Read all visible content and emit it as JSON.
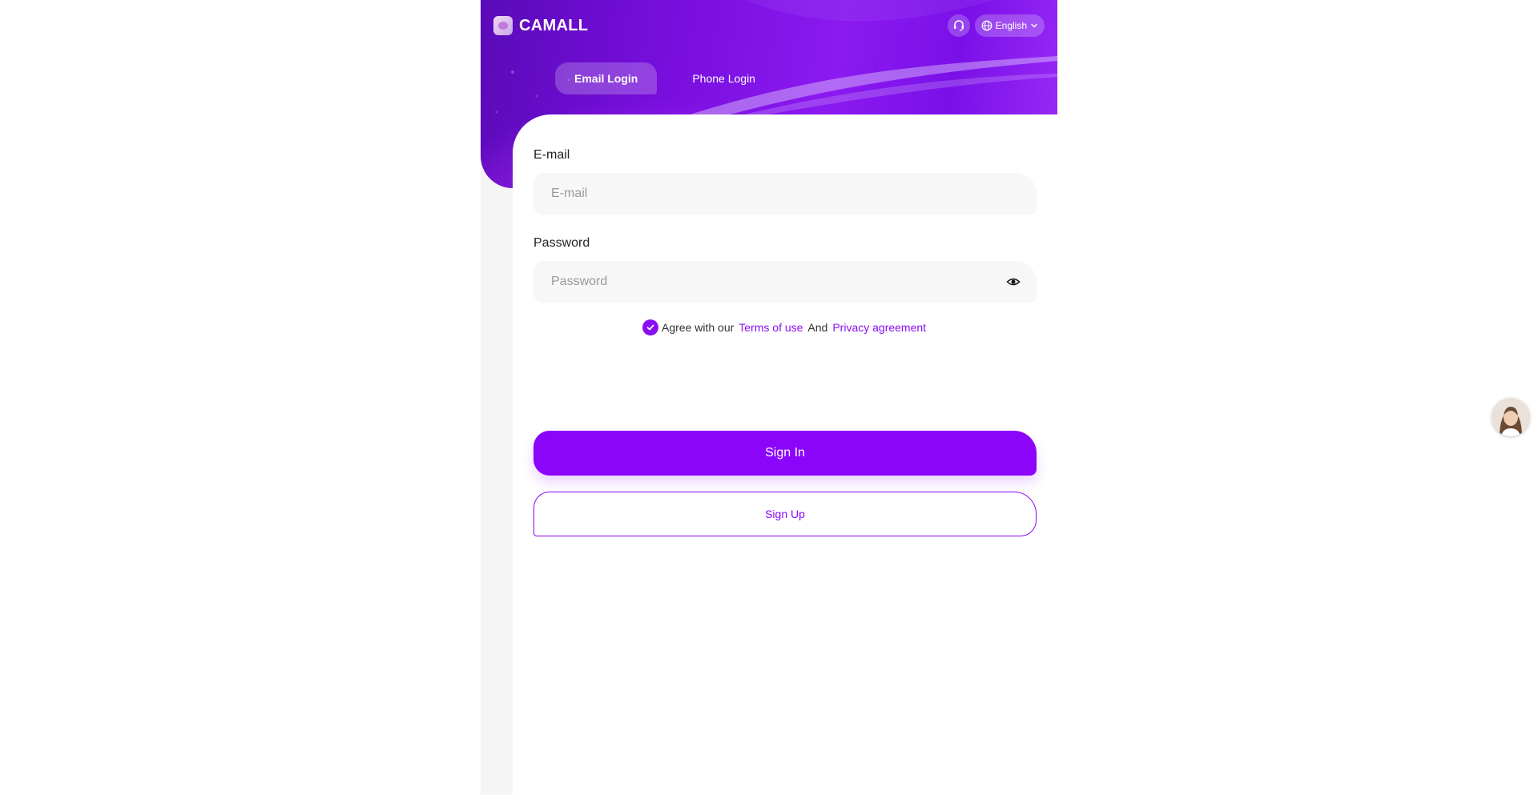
{
  "brand": {
    "name": "CAMALL",
    "logo_icon": "camall-logo-icon"
  },
  "header": {
    "support_icon": "headset-icon",
    "language": {
      "icon": "globe-icon",
      "label": "English",
      "chevron": "chevron-down-icon"
    }
  },
  "tabs": [
    {
      "label": "Email Login",
      "active": true
    },
    {
      "label": "Phone Login",
      "active": false
    }
  ],
  "form": {
    "email": {
      "label": "E-mail",
      "placeholder": "E-mail",
      "value": ""
    },
    "password": {
      "label": "Password",
      "placeholder": "Password",
      "value": "",
      "toggle_icon": "eye-icon"
    },
    "agreement": {
      "checked": true,
      "prefix": "Agree with our",
      "terms_link": "Terms of use",
      "conjunction": "And",
      "privacy_link": "Privacy agreement"
    },
    "sign_in_label": "Sign In",
    "sign_up_label": "Sign Up"
  },
  "support_avatar": {
    "icon": "customer-service-avatar"
  },
  "colors": {
    "accent": "#8b05fb",
    "header_gradient_start": "#5a0ab8",
    "header_gradient_end": "#9a2cf8",
    "page_background": "#ffffff",
    "panel_background": "#f5f5f5"
  }
}
